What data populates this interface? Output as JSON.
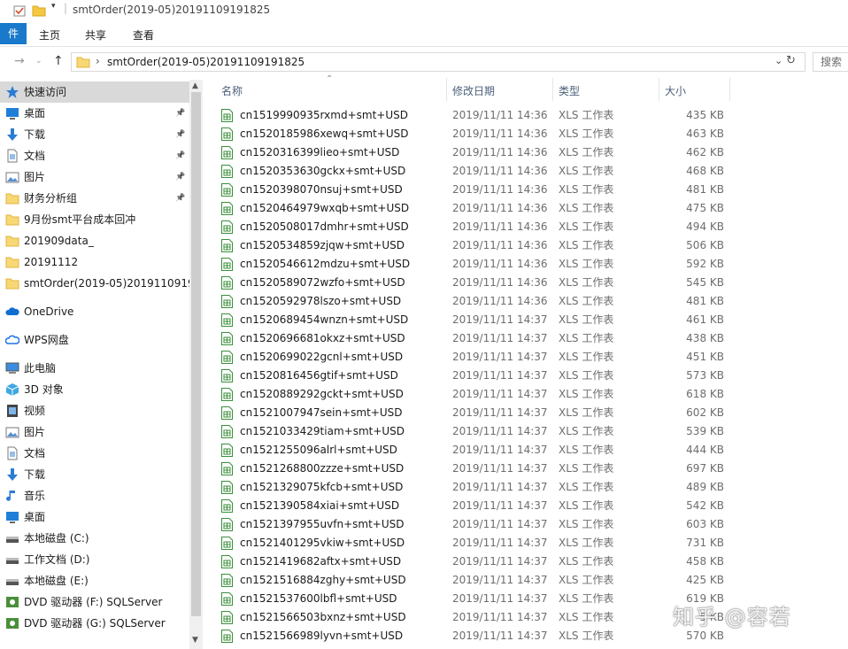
{
  "window": {
    "title": "smtOrder(2019-05)20191109191825"
  },
  "ribbon": {
    "tabs": [
      {
        "label": "件"
      },
      {
        "label": "主页"
      },
      {
        "label": "共享"
      },
      {
        "label": "查看"
      }
    ]
  },
  "address": {
    "path": "smtOrder(2019-05)20191109191825",
    "search_placeholder": "搜索"
  },
  "sidebar": {
    "items": [
      {
        "label": "快速访问",
        "icon": "star-icon",
        "pinned": false,
        "selected": true
      },
      {
        "label": "桌面",
        "icon": "desktop-icon",
        "pinned": true
      },
      {
        "label": "下载",
        "icon": "download-icon",
        "pinned": true
      },
      {
        "label": "文档",
        "icon": "document-icon",
        "pinned": true
      },
      {
        "label": "图片",
        "icon": "picture-icon",
        "pinned": true
      },
      {
        "label": "财务分析组",
        "icon": "folder-icon",
        "pinned": true
      },
      {
        "label": "9月份smt平台成本回冲",
        "icon": "folder-icon",
        "pinned": false
      },
      {
        "label": "201909data_",
        "icon": "folder-icon",
        "pinned": false
      },
      {
        "label": "20191112",
        "icon": "folder-icon",
        "pinned": false
      },
      {
        "label": "smtOrder(2019-05)20191109191",
        "icon": "folder-icon",
        "pinned": false
      },
      {
        "label": "OneDrive",
        "icon": "cloud-icon",
        "pinned": false
      },
      {
        "label": "WPS网盘",
        "icon": "wps-cloud-icon",
        "pinned": false
      },
      {
        "label": "此电脑",
        "icon": "computer-icon",
        "pinned": false
      },
      {
        "label": "3D 对象",
        "icon": "cube-icon",
        "pinned": false
      },
      {
        "label": "视频",
        "icon": "video-icon",
        "pinned": false
      },
      {
        "label": "图片",
        "icon": "picture-icon",
        "pinned": false
      },
      {
        "label": "文档",
        "icon": "document-icon",
        "pinned": false
      },
      {
        "label": "下载",
        "icon": "download-icon",
        "pinned": false
      },
      {
        "label": "音乐",
        "icon": "music-icon",
        "pinned": false
      },
      {
        "label": "桌面",
        "icon": "desktop-icon",
        "pinned": false
      },
      {
        "label": "本地磁盘 (C:)",
        "icon": "drive-icon",
        "pinned": false
      },
      {
        "label": "工作文档 (D:)",
        "icon": "drive-icon",
        "pinned": false
      },
      {
        "label": "本地磁盘 (E:)",
        "icon": "drive-icon",
        "pinned": false
      },
      {
        "label": "DVD 驱动器 (F:) SQLServer",
        "icon": "dvd-icon",
        "pinned": false
      },
      {
        "label": "DVD 驱动器 (G:) SQLServer",
        "icon": "dvd-icon",
        "pinned": false
      }
    ]
  },
  "columns": {
    "name": "名称",
    "modified": "修改日期",
    "type": "类型",
    "size": "大小"
  },
  "files": [
    {
      "name": "cn1519990935rxmd+smt+USD",
      "date": "2019/11/11 14:36",
      "type": "XLS 工作表",
      "size": "435 KB"
    },
    {
      "name": "cn1520185986xewq+smt+USD",
      "date": "2019/11/11 14:36",
      "type": "XLS 工作表",
      "size": "463 KB"
    },
    {
      "name": "cn1520316399lieo+smt+USD",
      "date": "2019/11/11 14:36",
      "type": "XLS 工作表",
      "size": "462 KB"
    },
    {
      "name": "cn1520353630gckx+smt+USD",
      "date": "2019/11/11 14:36",
      "type": "XLS 工作表",
      "size": "468 KB"
    },
    {
      "name": "cn1520398070nsuj+smt+USD",
      "date": "2019/11/11 14:36",
      "type": "XLS 工作表",
      "size": "481 KB"
    },
    {
      "name": "cn1520464979wxqb+smt+USD",
      "date": "2019/11/11 14:36",
      "type": "XLS 工作表",
      "size": "475 KB"
    },
    {
      "name": "cn1520508017dmhr+smt+USD",
      "date": "2019/11/11 14:36",
      "type": "XLS 工作表",
      "size": "494 KB"
    },
    {
      "name": "cn1520534859zjqw+smt+USD",
      "date": "2019/11/11 14:36",
      "type": "XLS 工作表",
      "size": "506 KB"
    },
    {
      "name": "cn1520546612mdzu+smt+USD",
      "date": "2019/11/11 14:36",
      "type": "XLS 工作表",
      "size": "592 KB"
    },
    {
      "name": "cn1520589072wzfo+smt+USD",
      "date": "2019/11/11 14:36",
      "type": "XLS 工作表",
      "size": "545 KB"
    },
    {
      "name": "cn1520592978lszo+smt+USD",
      "date": "2019/11/11 14:36",
      "type": "XLS 工作表",
      "size": "481 KB"
    },
    {
      "name": "cn1520689454wnzn+smt+USD",
      "date": "2019/11/11 14:37",
      "type": "XLS 工作表",
      "size": "461 KB"
    },
    {
      "name": "cn1520696681okxz+smt+USD",
      "date": "2019/11/11 14:37",
      "type": "XLS 工作表",
      "size": "438 KB"
    },
    {
      "name": "cn1520699022gcnl+smt+USD",
      "date": "2019/11/11 14:37",
      "type": "XLS 工作表",
      "size": "451 KB"
    },
    {
      "name": "cn1520816456gtif+smt+USD",
      "date": "2019/11/11 14:37",
      "type": "XLS 工作表",
      "size": "573 KB"
    },
    {
      "name": "cn1520889292gckt+smt+USD",
      "date": "2019/11/11 14:37",
      "type": "XLS 工作表",
      "size": "618 KB"
    },
    {
      "name": "cn1521007947sein+smt+USD",
      "date": "2019/11/11 14:37",
      "type": "XLS 工作表",
      "size": "602 KB"
    },
    {
      "name": "cn1521033429tiam+smt+USD",
      "date": "2019/11/11 14:37",
      "type": "XLS 工作表",
      "size": "539 KB"
    },
    {
      "name": "cn1521255096alrl+smt+USD",
      "date": "2019/11/11 14:37",
      "type": "XLS 工作表",
      "size": "444 KB"
    },
    {
      "name": "cn1521268800zzze+smt+USD",
      "date": "2019/11/11 14:37",
      "type": "XLS 工作表",
      "size": "697 KB"
    },
    {
      "name": "cn1521329075kfcb+smt+USD",
      "date": "2019/11/11 14:37",
      "type": "XLS 工作表",
      "size": "489 KB"
    },
    {
      "name": "cn1521390584xiai+smt+USD",
      "date": "2019/11/11 14:37",
      "type": "XLS 工作表",
      "size": "542 KB"
    },
    {
      "name": "cn1521397955uvfn+smt+USD",
      "date": "2019/11/11 14:37",
      "type": "XLS 工作表",
      "size": "603 KB"
    },
    {
      "name": "cn1521401295vkiw+smt+USD",
      "date": "2019/11/11 14:37",
      "type": "XLS 工作表",
      "size": "731 KB"
    },
    {
      "name": "cn1521419682aftx+smt+USD",
      "date": "2019/11/11 14:37",
      "type": "XLS 工作表",
      "size": "458 KB"
    },
    {
      "name": "cn1521516884zghy+smt+USD",
      "date": "2019/11/11 14:37",
      "type": "XLS 工作表",
      "size": "425 KB"
    },
    {
      "name": "cn1521537600lbfl+smt+USD",
      "date": "2019/11/11 14:37",
      "type": "XLS 工作表",
      "size": "619 KB"
    },
    {
      "name": "cn1521566503bxnz+smt+USD",
      "date": "2019/11/11 14:37",
      "type": "XLS 工作表",
      "size": "5 KB"
    },
    {
      "name": "cn1521566989lyvn+smt+USD",
      "date": "2019/11/11 14:37",
      "type": "XLS 工作表",
      "size": "570 KB"
    }
  ],
  "watermark": "知乎 @容若"
}
